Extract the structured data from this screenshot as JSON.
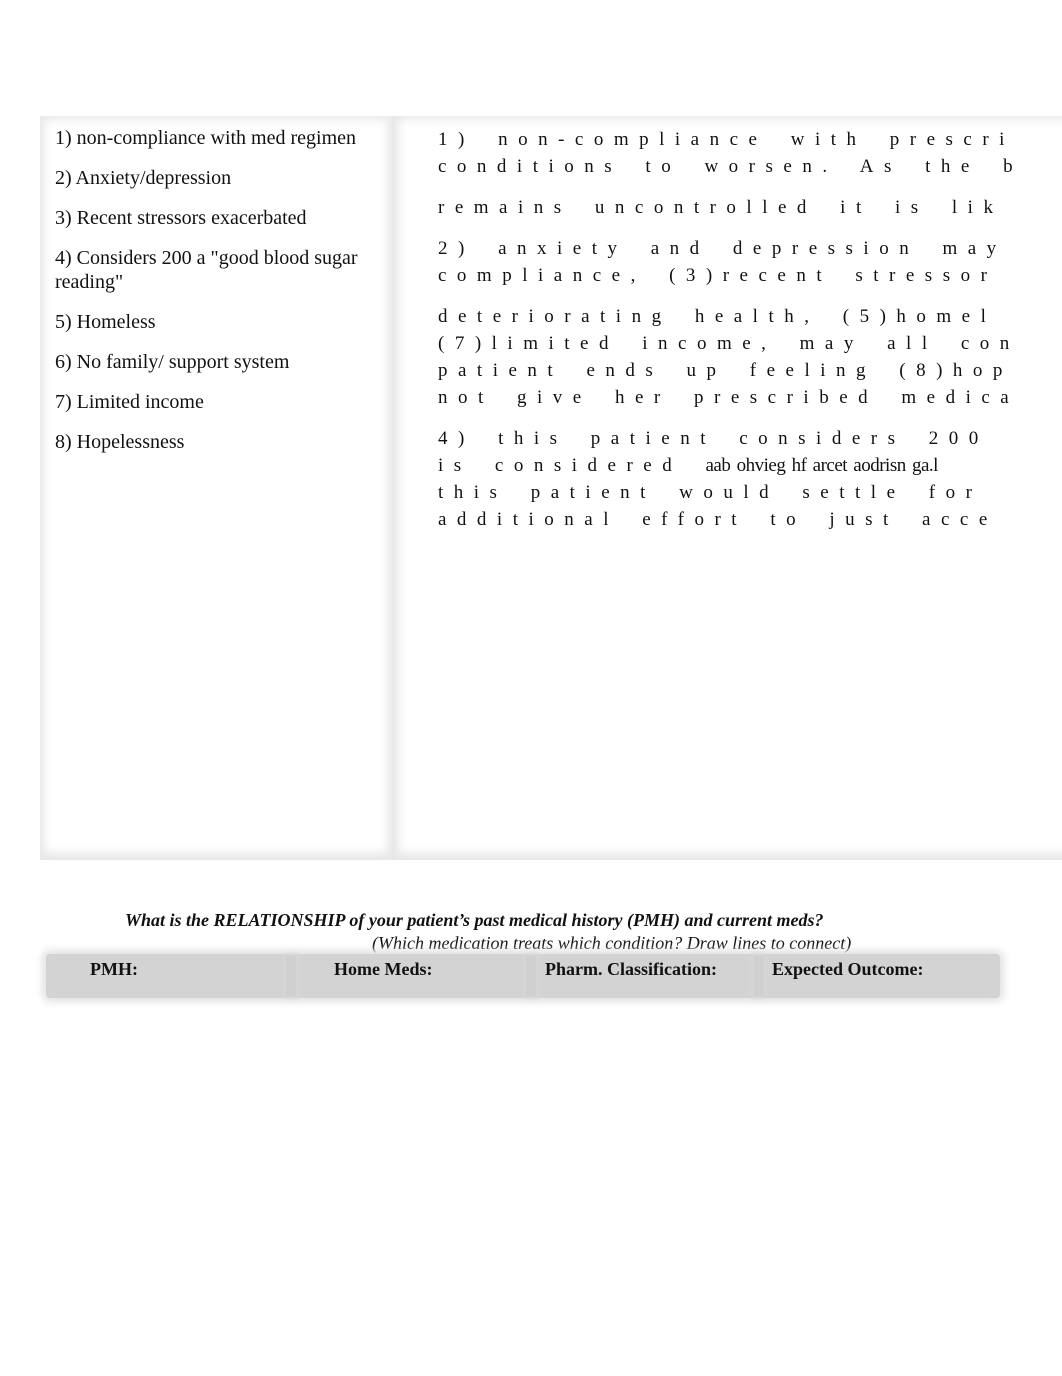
{
  "risk_factors": {
    "items": [
      "1) non-compliance with med regimen",
      "2) Anxiety/depression",
      "3) Recent stressors exacerbated",
      "4) Considers 200 a \"good blood sugar reading\"",
      "5) Homeless",
      "6) No family/ support system",
      "7) Limited income",
      "8) Hopelessness"
    ]
  },
  "rationale": {
    "paragraph1": {
      "line1": "1) non-compliance with prescri",
      "line2": "conditions to worsen. As the b"
    },
    "paragraph1b": {
      "line1": "remains uncontrolled it is lik"
    },
    "paragraph2": {
      "line1": "2) anxiety and depression may",
      "line2": "compliance, (3)recent stressor"
    },
    "paragraph3": {
      "line1": "deteriorating health, (5)homel",
      "line2": "(7)limited income, may all con",
      "line3": "patient ends up feeling (8)hop",
      "line4": "not give her prescribed medica"
    },
    "paragraph4": {
      "line1": "4) this patient considers 200",
      "line2_start": "is considered ",
      "line2_overlap": "aab ohvieg hf arcet aodrisn ga.l",
      "line3": "this patient would settle for",
      "line4": "additional effort to just acce"
    }
  },
  "relationship": {
    "question": "What is the RELATIONSHIP of your patient’s past medical history (PMH) and current meds?",
    "hint": "(Which medication treats which condition? Draw lines to connect)",
    "columns": [
      "PMH:",
      "Home Meds:",
      "Pharm. Classification:",
      "Expected Outcome:"
    ]
  }
}
